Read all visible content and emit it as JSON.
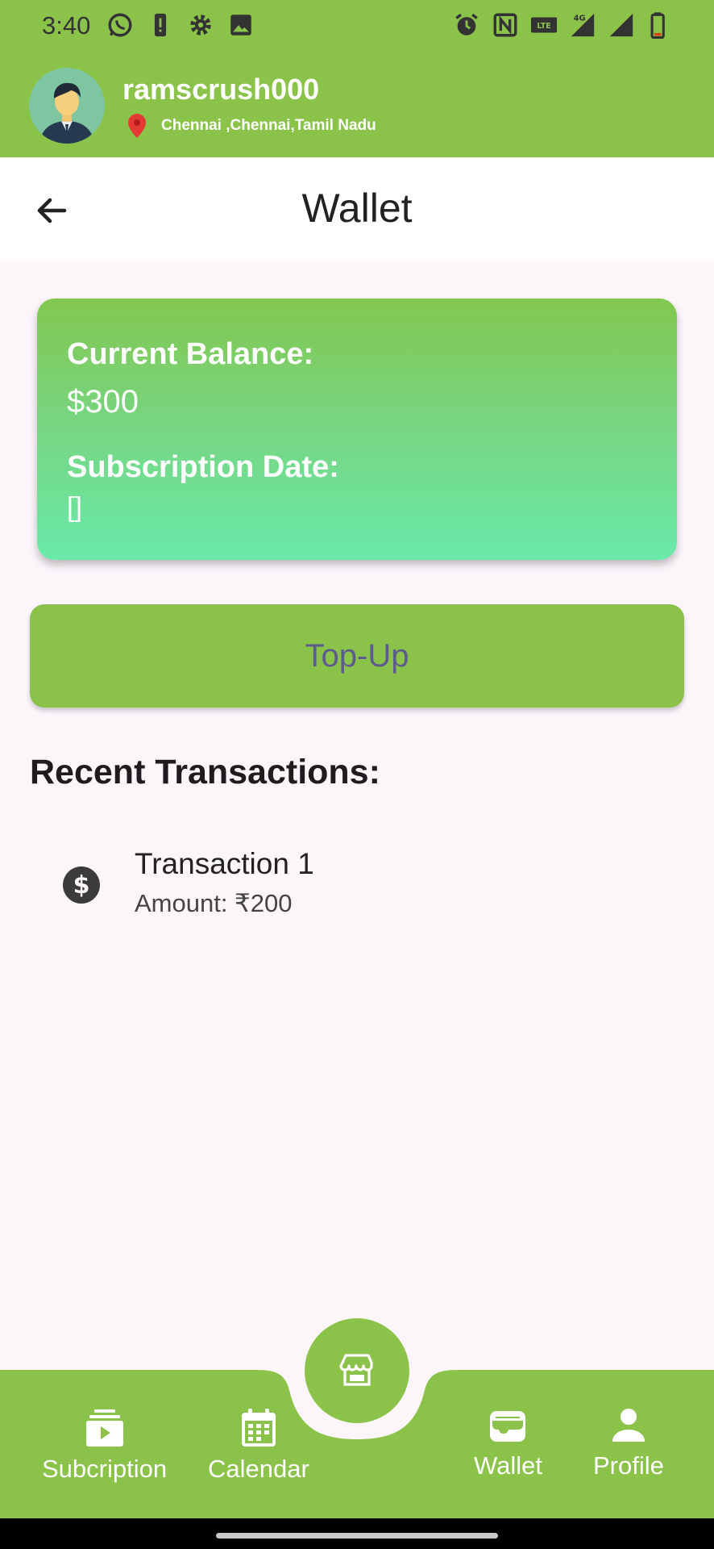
{
  "status_bar": {
    "time": "3:40",
    "left_icons": [
      "whatsapp-icon",
      "alert-icon",
      "gear-icon",
      "image-icon"
    ],
    "right_icons": [
      "alarm-icon",
      "nfc-icon",
      "volte-icon",
      "4g-signal-icon",
      "signal-icon",
      "battery-icon"
    ]
  },
  "header": {
    "username": "ramscrush000",
    "location": "Chennai ,Chennai,Tamil Nadu",
    "accent_color": "#8bc34a"
  },
  "titlebar": {
    "title": "Wallet"
  },
  "balance_card": {
    "balance_label": "Current Balance:",
    "balance_value": "$300",
    "subscription_label": "Subscription Date:",
    "subscription_value": "[]"
  },
  "topup": {
    "label": "Top-Up"
  },
  "transactions": {
    "heading": "Recent Transactions:",
    "items": [
      {
        "title": "Transaction 1",
        "amount": "Amount:  ₹200",
        "icon": "dollar-circle-icon"
      }
    ]
  },
  "bottom_nav": {
    "items": [
      {
        "label": "Subcription",
        "icon": "subscriptions-icon"
      },
      {
        "label": "Calendar",
        "icon": "calendar-icon"
      },
      {
        "label": "Wallet",
        "icon": "wallet-icon"
      },
      {
        "label": "Profile",
        "icon": "person-icon"
      }
    ],
    "fab_icon": "store-icon"
  }
}
